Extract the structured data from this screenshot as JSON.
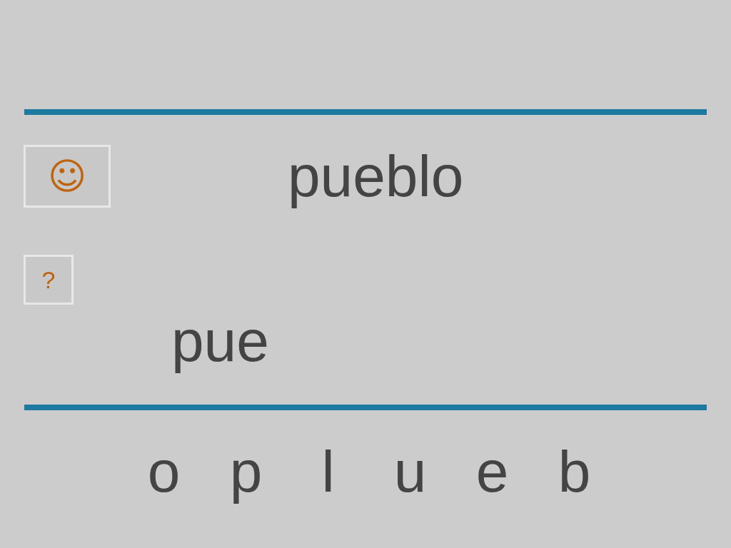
{
  "buttons": [
    {
      "kind": "smiley",
      "label": "☺"
    },
    {
      "kind": "hint",
      "label": "?"
    }
  ],
  "word": "pueblo",
  "answer": "pue",
  "letters": [
    "o",
    "p",
    "l",
    "u",
    "e",
    "b"
  ]
}
